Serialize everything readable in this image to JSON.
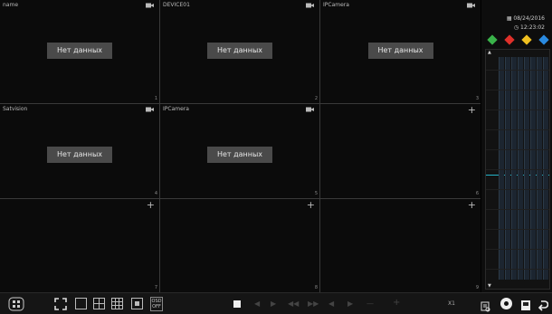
{
  "cells": [
    {
      "title": "name",
      "number": "1",
      "has_camera": true,
      "no_data": "Нет данных"
    },
    {
      "title": "DEVICE01",
      "number": "2",
      "has_camera": true,
      "no_data": "Нет данных"
    },
    {
      "title": "IPCamera",
      "number": "3",
      "has_camera": true,
      "no_data": "Нет данных"
    },
    {
      "title": "Satvision",
      "number": "4",
      "has_camera": true,
      "no_data": "Нет данных"
    },
    {
      "title": "IPCamera",
      "number": "5",
      "has_camera": true,
      "no_data": "Нет данных"
    },
    {
      "title": "",
      "number": "6",
      "has_camera": false,
      "no_data": ""
    },
    {
      "title": "",
      "number": "7",
      "has_camera": false,
      "no_data": ""
    },
    {
      "title": "",
      "number": "8",
      "has_camera": false,
      "no_data": ""
    },
    {
      "title": "",
      "number": "9",
      "has_camera": false,
      "no_data": ""
    }
  ],
  "add_icon": "+",
  "sidebar": {
    "date": "08/24/2016",
    "time": "12:23:02",
    "event_filters": [
      {
        "name": "motion-filter-icon",
        "color": "#3ab34a"
      },
      {
        "name": "alarm-filter-icon",
        "color": "#e0302a"
      },
      {
        "name": "schedule-filter-icon",
        "color": "#f0c020"
      },
      {
        "name": "manual-filter-icon",
        "color": "#2a8ae0"
      }
    ],
    "timeline_marker_color": "#23b3c8"
  },
  "toolbar": {
    "speed": "X1",
    "osd_label_top": "OSD",
    "osd_label_bottom": "OFF",
    "layout_icons": [
      "start-menu-icon",
      "fullscreen-icon",
      "layout-1-icon",
      "layout-4-icon",
      "layout-9-icon",
      "layout-16-icon"
    ],
    "playback_icons": [
      "stop-icon",
      "prev-frame-icon",
      "play-icon",
      "rewind-icon",
      "fast-forward-icon",
      "prev-icon",
      "next-icon",
      "zoom-out-icon",
      "zoom-in-icon"
    ],
    "right_icons": [
      "search-icon",
      "record-icon",
      "backup-icon",
      "back-icon"
    ]
  }
}
